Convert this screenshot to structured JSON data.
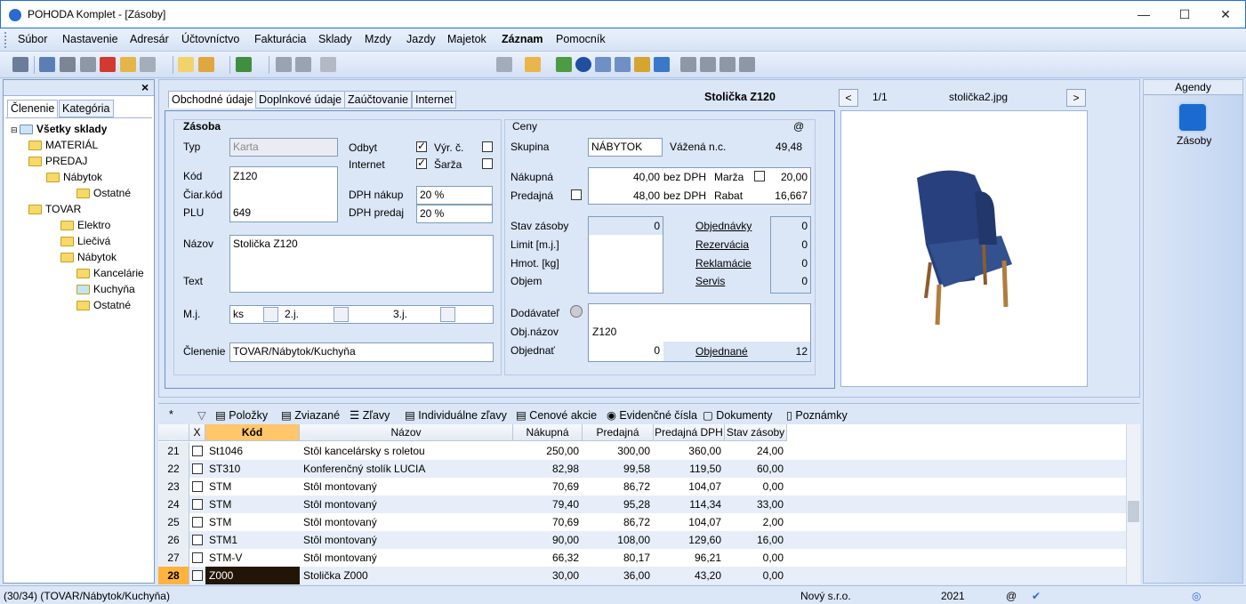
{
  "window": {
    "title": "POHODA Komplet - [Zásoby]",
    "minimize": "—",
    "maximize": "☐",
    "close": "✕"
  },
  "menu": [
    "Súbor",
    "Nastavenie",
    "Adresár",
    "Účtovníctvo",
    "Fakturácia",
    "Sklady",
    "Mzdy",
    "Jazdy",
    "Majetok",
    "Záznam",
    "Pomocník"
  ],
  "left": {
    "close": "×",
    "tabs": [
      "Členenie",
      "Kategória"
    ],
    "tree": [
      "Všetky sklady",
      "MATERIÁL",
      "PREDAJ",
      "Nábytok",
      "Ostatné",
      "TOVAR",
      "Elektro",
      "Liečivá",
      "Nábytok",
      "Kancelárie",
      "Kuchyňa",
      "Ostatné"
    ]
  },
  "form": {
    "tabs": [
      "Obchodné údaje",
      "Doplnkové údaje",
      "Zaúčtovanie",
      "Internet"
    ],
    "header": "Stolička Z120",
    "zasoba": "Zásoba",
    "typ_label": "Typ",
    "typ_value": "Karta",
    "odbyt": "Odbyt",
    "vyr": "Výr. č.",
    "internet": "Internet",
    "sarza": "Šarža",
    "kod_label": "Kód",
    "kod_value": "Z120",
    "ciar_label": "Čiar.kód",
    "plu_label": "PLU",
    "plu_value": "649",
    "dph_nakup_label": "DPH nákup",
    "dph_nakup": "20 %",
    "dph_predaj_label": "DPH predaj",
    "dph_predaj": "20 %",
    "nazov_label": "Názov",
    "nazov_value": "Stolička Z120",
    "text_label": "Text",
    "mj_label": "M.j.",
    "mj_value": "ks",
    "mj2": "2.j.",
    "mj3": "3.j.",
    "clenenie_label": "Členenie",
    "clenenie_value": "TOVAR/Nábytok/Kuchyňa",
    "ceny": "Ceny",
    "at": "@",
    "skupina_label": "Skupina",
    "skupina_value": "NÁBYTOK",
    "vazena_label": "Vážená n.c.",
    "vazena_value": "49,48",
    "nakupna_label": "Nákupná",
    "nakupna_value": "40,00",
    "bez_dph1": "bez DPH",
    "marza_label": "Marža",
    "marza_value": "20,00",
    "predajna_label": "Predajná",
    "predajna_value": "48,00",
    "bez_dph2": "bez DPH",
    "rabat_label": "Rabat",
    "rabat_value": "16,667",
    "stav_label": "Stav zásoby",
    "stav_value": "0",
    "limit_label": "Limit [m.j.]",
    "hmot_label": "Hmot. [kg]",
    "objem_label": "Objem",
    "objednavky": "Objednávky",
    "objednavky_v": "0",
    "rezervacia": "Rezervácia",
    "rezervacia_v": "0",
    "reklamacie": "Reklamácie",
    "reklamacie_v": "0",
    "servis": "Servis",
    "servis_v": "0",
    "dodavatel_label": "Dodávateľ",
    "objnazov_label": "Obj.názov",
    "objnazov_value": "Z120",
    "objednat_label": "Objednať",
    "objednat_value": "0",
    "objednane": "Objednané",
    "objednane_value": "12"
  },
  "image": {
    "counter": "1/1",
    "filename": "stolička2.jpg",
    "prev": "<",
    "next": ">"
  },
  "grid": {
    "tabs": [
      "*",
      "Položky",
      "Zviazané",
      "Zľavy",
      "Individuálne zľavy",
      "Cenové akcie",
      "Evidenčné čísla",
      "Dokumenty",
      "Poznámky"
    ],
    "columns": [
      "X",
      "Kód",
      "Názov",
      "Nákupná",
      "Predajná",
      "Predajná DPH",
      "Stav zásoby"
    ],
    "rows": [
      [
        "21",
        "St1046",
        "Stôl kancelársky s roletou",
        "250,00",
        "300,00",
        "360,00",
        "24,00"
      ],
      [
        "22",
        "ST310",
        "Konferenčný stolík LUCIA",
        "82,98",
        "99,58",
        "119,50",
        "60,00"
      ],
      [
        "23",
        "STM",
        "Stôl montovaný",
        "70,69",
        "86,72",
        "104,07",
        "0,00"
      ],
      [
        "24",
        "STM",
        "Stôl montovaný",
        "79,40",
        "95,28",
        "114,34",
        "33,00"
      ],
      [
        "25",
        "STM",
        "Stôl montovaný",
        "70,69",
        "86,72",
        "104,07",
        "2,00"
      ],
      [
        "26",
        "STM1",
        "Stôl montovaný",
        "90,00",
        "108,00",
        "129,60",
        "16,00"
      ],
      [
        "27",
        "STM-V",
        "Stôl montovaný",
        "66,32",
        "80,17",
        "96,21",
        "0,00"
      ],
      [
        "28",
        "Z000",
        "Stolička Z000",
        "30,00",
        "36,00",
        "43,20",
        "0,00"
      ]
    ]
  },
  "agendy": {
    "title": "Agendy",
    "item": "Zásoby"
  },
  "status": {
    "left": "(30/34) (TOVAR/Nábytok/Kuchyňa)",
    "company": "Nový s.r.o.",
    "year": "2021",
    "at": "@"
  },
  "colors": {
    "accent": "#ffb33c",
    "selected": "#231505"
  }
}
